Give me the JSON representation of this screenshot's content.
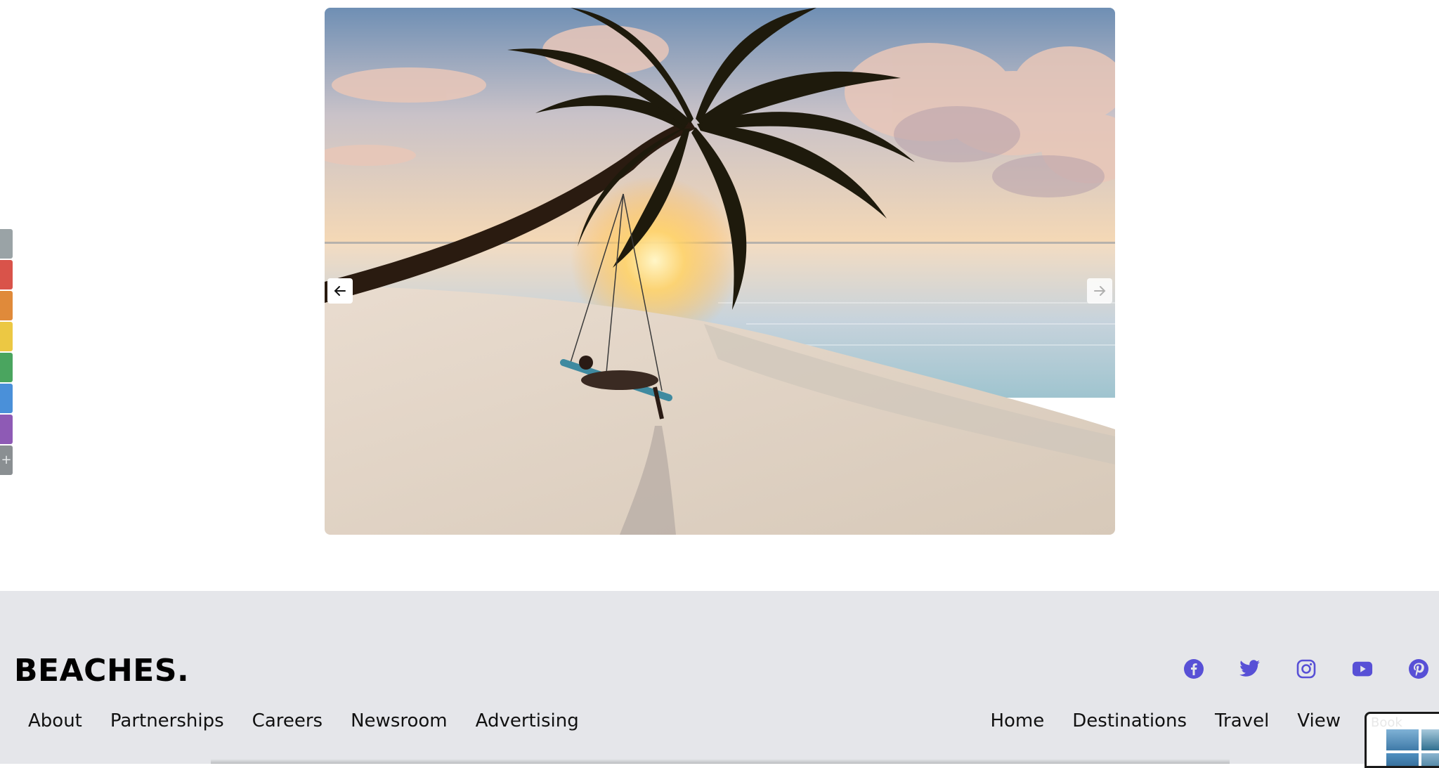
{
  "palette": {
    "colors": [
      "#9aa3a6",
      "#d9534a",
      "#e08a3a",
      "#ecc843",
      "#4aa55f",
      "#4a90d9",
      "#8e5ab5"
    ],
    "add_label": "+"
  },
  "hero": {
    "image_description": "palm-tree-sunset-beach-swing",
    "prev_icon": "arrow-left-icon",
    "next_icon": "arrow-right-icon"
  },
  "footer": {
    "brand": "BEACHES.",
    "accent_color": "#5850d6",
    "social": [
      {
        "name": "facebook-icon"
      },
      {
        "name": "twitter-icon"
      },
      {
        "name": "instagram-icon"
      },
      {
        "name": "youtube-icon"
      },
      {
        "name": "pinterest-icon"
      }
    ],
    "links_left": [
      "About",
      "Partnerships",
      "Careers",
      "Newsroom",
      "Advertising"
    ],
    "links_right": [
      "Home",
      "Destinations",
      "Travel",
      "View"
    ],
    "booking_label": "Book"
  }
}
